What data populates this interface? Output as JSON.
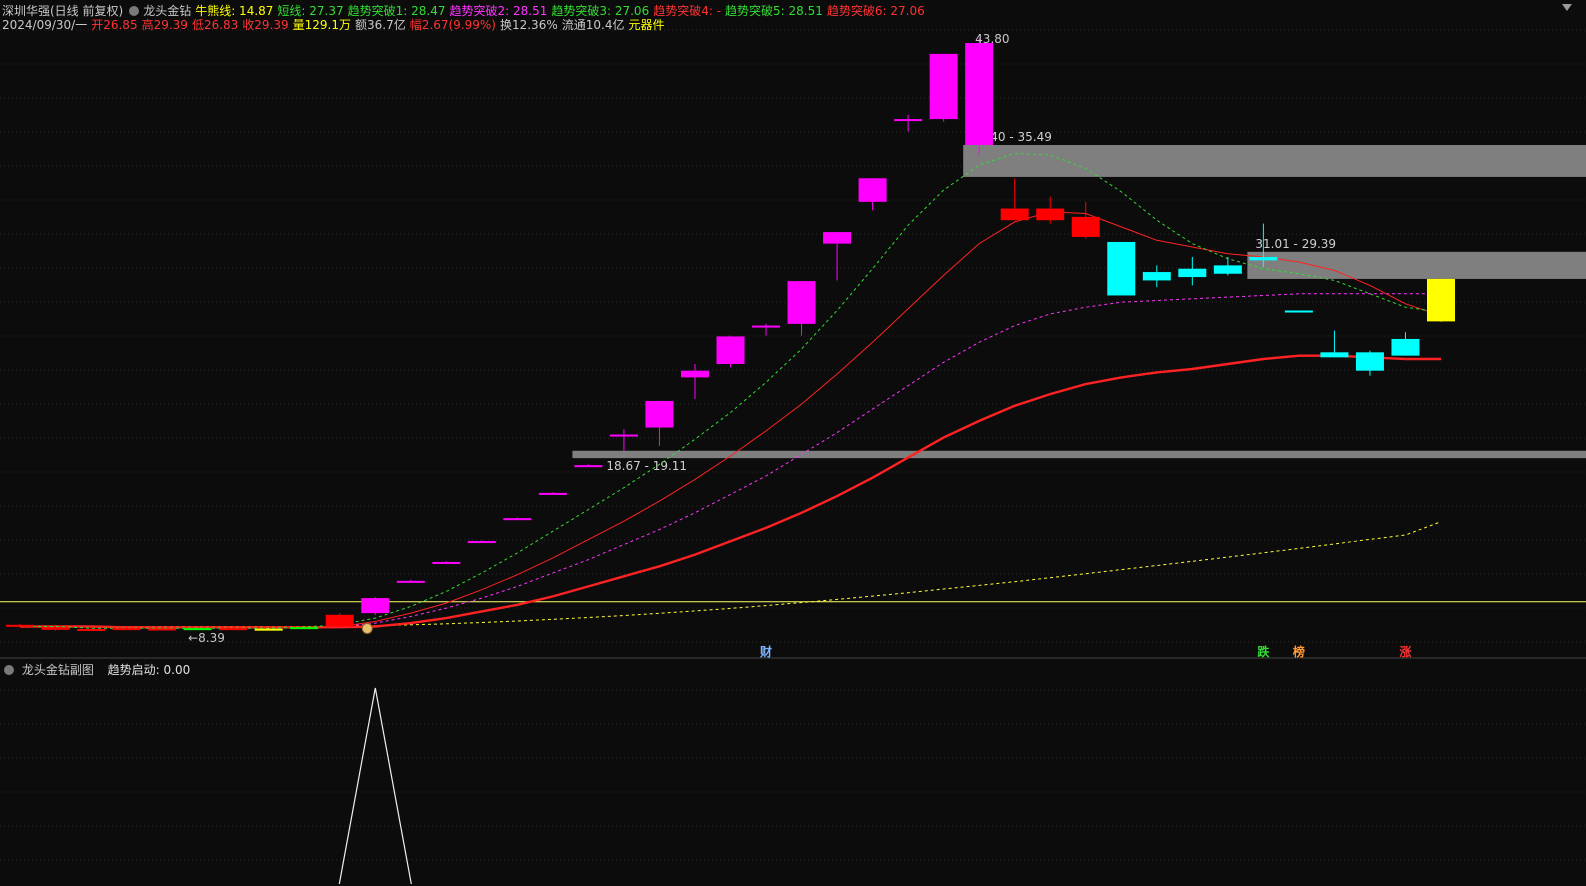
{
  "header": {
    "line1": [
      {
        "text": "深圳华强(日线 前复权)",
        "color": "#c8c8c8"
      },
      {
        "text": "龙头金钻",
        "color": "#c8c8c8",
        "icon": "circle-icon"
      },
      {
        "text": "牛熊线: 14.87",
        "color": "#ffff00"
      },
      {
        "text": "短线: 27.37",
        "color": "#33dd33"
      },
      {
        "text": "趋势突破1: 28.47",
        "color": "#33dd33"
      },
      {
        "text": "趋势突破2: 28.51",
        "color": "#ff33ff"
      },
      {
        "text": "趋势突破3: 27.06",
        "color": "#33dd33"
      },
      {
        "text": "趋势突破4: -",
        "color": "#ff3333"
      },
      {
        "text": "趋势突破5: 28.51",
        "color": "#33dd33"
      },
      {
        "text": "趋势突破6: 27.06",
        "color": "#ff3333"
      }
    ],
    "line2": [
      {
        "text": "2024/09/30/一",
        "color": "#c8c8c8"
      },
      {
        "text": "开26.85",
        "color": "#ff3333"
      },
      {
        "text": "高29.39",
        "color": "#ff3333"
      },
      {
        "text": "低26.83",
        "color": "#ff3333"
      },
      {
        "text": "收29.39",
        "color": "#ff3333"
      },
      {
        "text": "量129.1万",
        "color": "#ffff00"
      },
      {
        "text": "额36.7亿",
        "color": "#c8c8c8"
      },
      {
        "text": "幅2.67(9.99%)",
        "color": "#ff3333"
      },
      {
        "text": "换12.36%",
        "color": "#c8c8c8"
      },
      {
        "text": "流通10.4亿",
        "color": "#c8c8c8"
      },
      {
        "text": "元器件",
        "color": "#ffff00"
      }
    ]
  },
  "sub_header": {
    "title": "龙头金钻副图",
    "indicator": "趋势启动: 0.00"
  },
  "chart_data": [
    {
      "type": "candlestick",
      "candles": [
        {
          "o": 8.7,
          "h": 8.75,
          "l": 8.55,
          "c": 8.58,
          "color": "#ff0000"
        },
        {
          "o": 8.55,
          "h": 8.58,
          "l": 8.35,
          "c": 8.4,
          "color": "#ff0000"
        },
        {
          "o": 8.45,
          "h": 8.5,
          "l": 8.39,
          "c": 8.42,
          "color": "#ff0000"
        },
        {
          "o": 8.5,
          "h": 8.55,
          "l": 8.45,
          "c": 8.48,
          "color": "#ff0000"
        },
        {
          "o": 8.48,
          "h": 8.52,
          "l": 8.43,
          "c": 8.45,
          "color": "#ff0000"
        },
        {
          "o": 8.5,
          "h": 8.55,
          "l": 8.46,
          "c": 8.48,
          "color": "#00ff00"
        },
        {
          "o": 8.5,
          "h": 8.56,
          "l": 8.46,
          "c": 8.5,
          "color": "#ff0000"
        },
        {
          "o": 8.45,
          "h": 8.5,
          "l": 8.42,
          "c": 8.47,
          "color": "#ffff00"
        },
        {
          "o": 8.55,
          "h": 8.6,
          "l": 8.5,
          "c": 8.56,
          "color": "#00ff00"
        },
        {
          "o": 9.3,
          "h": 9.4,
          "l": 8.55,
          "c": 8.6,
          "color": "#ff0000"
        },
        {
          "o": 9.4,
          "h": 10.35,
          "l": 9.3,
          "c": 10.3,
          "color": "#ff00ff"
        },
        {
          "o": 11.33,
          "h": 11.4,
          "l": 11.28,
          "c": 11.33,
          "color": "#ff00ff"
        },
        {
          "o": 12.46,
          "h": 12.5,
          "l": 12.4,
          "c": 12.46,
          "color": "#ff00ff"
        },
        {
          "o": 13.71,
          "h": 13.75,
          "l": 13.65,
          "c": 13.71,
          "color": "#ff00ff"
        },
        {
          "o": 15.08,
          "h": 15.12,
          "l": 15.0,
          "c": 15.08,
          "color": "#ff00ff"
        },
        {
          "o": 16.59,
          "h": 16.63,
          "l": 16.55,
          "c": 16.59,
          "color": "#ff00ff"
        },
        {
          "o": 18.25,
          "h": 18.3,
          "l": 18.2,
          "c": 18.25,
          "color": "#ff00ff"
        },
        {
          "o": 20.0,
          "h": 20.4,
          "l": 19.1,
          "c": 20.08,
          "color": "#ff00ff"
        },
        {
          "o": 20.5,
          "h": 22.1,
          "l": 19.4,
          "c": 22.09,
          "color": "#ff00ff"
        },
        {
          "o": 23.5,
          "h": 24.3,
          "l": 22.2,
          "c": 23.9,
          "color": "#ff00ff"
        },
        {
          "o": 24.3,
          "h": 26.0,
          "l": 24.1,
          "c": 25.95,
          "color": "#ff00ff"
        },
        {
          "o": 26.5,
          "h": 26.7,
          "l": 26.0,
          "c": 26.6,
          "color": "#ff00ff"
        },
        {
          "o": 26.7,
          "h": 29.26,
          "l": 26.0,
          "c": 29.26,
          "color": "#ff00ff"
        },
        {
          "o": 31.5,
          "h": 32.2,
          "l": 29.3,
          "c": 32.19,
          "color": "#ff00ff"
        },
        {
          "o": 34.0,
          "h": 35.41,
          "l": 33.5,
          "c": 35.41,
          "color": "#ff00ff"
        },
        {
          "o": 38.95,
          "h": 39.2,
          "l": 38.2,
          "c": 38.95,
          "color": "#ff00ff"
        },
        {
          "o": 38.95,
          "h": 42.85,
          "l": 38.8,
          "c": 42.85,
          "color": "#ff00ff"
        },
        {
          "o": 43.5,
          "h": 43.8,
          "l": 36.8,
          "c": 37.4,
          "color": "#ff00ff"
        },
        {
          "o": 33.6,
          "h": 35.4,
          "l": 32.9,
          "c": 32.9,
          "color": "#ff0000"
        },
        {
          "o": 33.6,
          "h": 34.3,
          "l": 32.7,
          "c": 32.9,
          "color": "#ff0000"
        },
        {
          "o": 33.1,
          "h": 34.0,
          "l": 31.8,
          "c": 31.9,
          "color": "#ff0000"
        },
        {
          "o": 31.6,
          "h": 31.6,
          "l": 28.4,
          "c": 28.4,
          "color": "#00ffff"
        },
        {
          "o": 29.3,
          "h": 30.2,
          "l": 28.9,
          "c": 29.8,
          "color": "#00ffff"
        },
        {
          "o": 30.0,
          "h": 30.7,
          "l": 29.0,
          "c": 29.5,
          "color": "#00ffff"
        },
        {
          "o": 30.2,
          "h": 30.7,
          "l": 29.6,
          "c": 29.7,
          "color": "#00ffff"
        },
        {
          "o": 30.7,
          "h": 32.7,
          "l": 30.1,
          "c": 30.5,
          "color": "#00ffff"
        },
        {
          "o": 27.5,
          "h": 27.5,
          "l": 27.4,
          "c": 27.45,
          "color": "#00ffff"
        },
        {
          "o": 25.0,
          "h": 26.3,
          "l": 24.7,
          "c": 24.7,
          "color": "#00ffff"
        },
        {
          "o": 25.0,
          "h": 25.1,
          "l": 23.6,
          "c": 23.9,
          "color": "#00ffff"
        },
        {
          "o": 25.8,
          "h": 26.2,
          "l": 24.8,
          "c": 24.8,
          "color": "#00ffff"
        },
        {
          "o": 26.85,
          "h": 29.39,
          "l": 26.83,
          "c": 29.39,
          "color": "#ffff00"
        }
      ],
      "lines": {
        "short_dashed_green": {
          "color": "#33dd33",
          "dash": true,
          "values": [
            8.6,
            8.6,
            8.5,
            8.5,
            8.5,
            8.5,
            8.5,
            8.5,
            8.55,
            8.7,
            9.1,
            9.8,
            10.7,
            11.8,
            13.0,
            14.3,
            15.6,
            16.9,
            18.3,
            19.8,
            21.4,
            23.2,
            25.2,
            27.5,
            30.0,
            32.6,
            34.7,
            36.2,
            36.9,
            36.8,
            36.0,
            34.6,
            32.9,
            31.5,
            30.6,
            30.0,
            29.7,
            29.3,
            28.5,
            27.7,
            27.4
          ]
        },
        "thin_red": {
          "color": "#ff2222",
          "dash": false,
          "values": [
            8.6,
            8.6,
            8.6,
            8.6,
            8.55,
            8.55,
            8.55,
            8.55,
            8.55,
            8.6,
            8.9,
            9.4,
            10.0,
            10.8,
            11.7,
            12.7,
            13.8,
            14.9,
            16.1,
            17.4,
            18.8,
            20.3,
            21.9,
            23.7,
            25.6,
            27.6,
            29.6,
            31.5,
            32.8,
            33.4,
            33.3,
            32.5,
            31.7,
            31.3,
            30.9,
            30.7,
            30.4,
            29.9,
            29.0,
            27.9,
            27.2
          ]
        },
        "magenta_dashed": {
          "color": "#ff33ff",
          "dash": true,
          "values": [
            8.6,
            8.6,
            8.6,
            8.55,
            8.55,
            8.55,
            8.55,
            8.55,
            8.55,
            8.58,
            8.8,
            9.2,
            9.7,
            10.3,
            11.0,
            11.8,
            12.6,
            13.5,
            14.4,
            15.4,
            16.5,
            17.6,
            18.9,
            20.2,
            21.6,
            23.0,
            24.4,
            25.6,
            26.6,
            27.3,
            27.7,
            28.0,
            28.1,
            28.2,
            28.3,
            28.4,
            28.5,
            28.5,
            28.5,
            28.5,
            28.51
          ]
        },
        "thick_red": {
          "color": "#ff2222",
          "dash": false,
          "width": 2.4,
          "values": [
            8.6,
            8.6,
            8.6,
            8.55,
            8.55,
            8.55,
            8.55,
            8.55,
            8.55,
            8.56,
            8.6,
            8.8,
            9.1,
            9.5,
            9.9,
            10.4,
            11.0,
            11.6,
            12.2,
            12.9,
            13.7,
            14.5,
            15.4,
            16.4,
            17.5,
            18.7,
            19.9,
            20.9,
            21.8,
            22.5,
            23.1,
            23.5,
            23.8,
            24.0,
            24.3,
            24.6,
            24.8,
            24.8,
            24.7,
            24.6,
            24.6
          ]
        },
        "yellow_bull_bear": {
          "color": "#ffff33",
          "dash": true,
          "values": [
            8.6,
            8.6,
            8.6,
            8.6,
            8.6,
            8.6,
            8.6,
            8.6,
            8.6,
            8.62,
            8.65,
            8.7,
            8.76,
            8.84,
            8.93,
            9.03,
            9.14,
            9.26,
            9.39,
            9.53,
            9.68,
            9.85,
            10.03,
            10.22,
            10.42,
            10.62,
            10.84,
            11.06,
            11.28,
            11.52,
            11.76,
            12.0,
            12.25,
            12.5,
            12.75,
            13.01,
            13.27,
            13.54,
            13.81,
            14.07,
            14.87
          ]
        }
      },
      "horizontal_line": {
        "price": 10.08,
        "color": "#ffff66"
      },
      "zones": [
        {
          "label": "37.40 - 35.49",
          "from": 27,
          "color": "#8c8c8c"
        },
        {
          "label": "31.01 - 29.39",
          "from": 35,
          "color": "#8c8c8c"
        },
        {
          "label": "18.67 - 19.11",
          "from": 16,
          "color": "#8c8c8c"
        }
      ],
      "annotations": [
        {
          "text": "43.80",
          "index": 27,
          "price": 43.8,
          "color": "#c8c8c8"
        },
        {
          "text": "←8.39",
          "index": 4,
          "price": 8.39,
          "color": "#c8c8c8"
        }
      ],
      "markers": [
        {
          "text": "财",
          "index": 21,
          "color": "#7fb3ff"
        },
        {
          "text": "跌",
          "index": 35,
          "color": "#33dd33"
        },
        {
          "text": "榜",
          "index": 36,
          "color": "#ff9933"
        },
        {
          "text": "涨",
          "index": 39,
          "color": "#ff3333"
        }
      ]
    },
    {
      "type": "line",
      "title": "龙头金钻副图",
      "series": [
        {
          "name": "趋势启动",
          "values": [
            0,
            0,
            0,
            0,
            0,
            0,
            0,
            0,
            0,
            0,
            1,
            0,
            0,
            0,
            0,
            0,
            0,
            0,
            0,
            0,
            0,
            0,
            0,
            0,
            0,
            0,
            0,
            0,
            0,
            0,
            0,
            0,
            0,
            0,
            0,
            0,
            0,
            0,
            0,
            0,
            0
          ]
        }
      ],
      "ylim": [
        0,
        1
      ]
    }
  ]
}
